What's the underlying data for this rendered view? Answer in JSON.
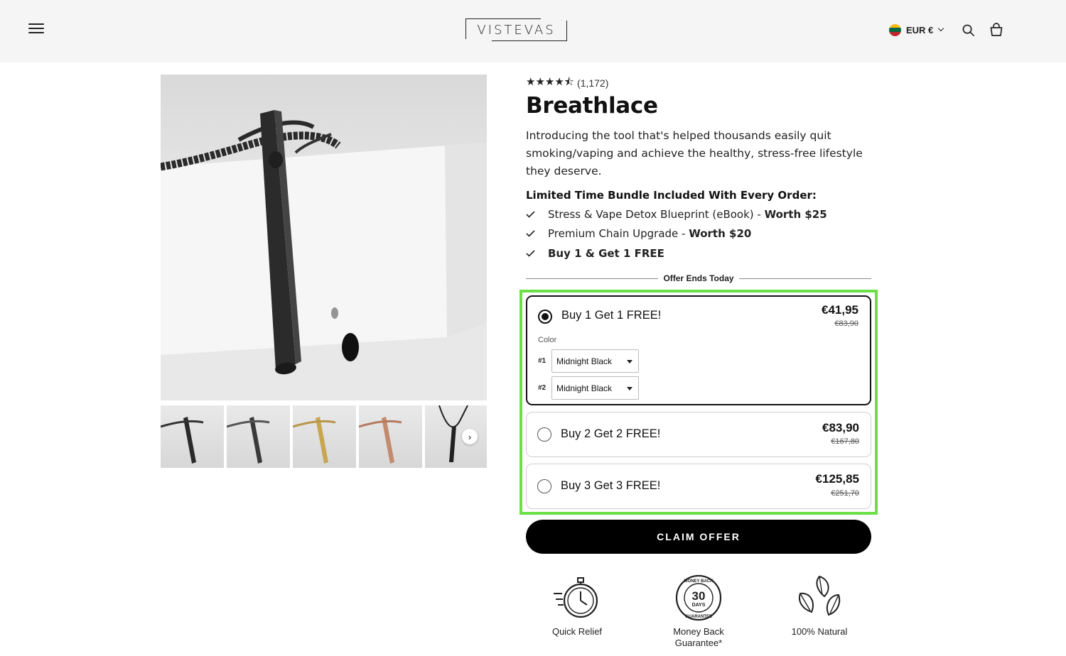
{
  "header": {
    "brand": "VISTEVAS",
    "currency": "EUR €",
    "icons": [
      "hamburger-menu-icon",
      "flag-icon",
      "chevron-down-icon",
      "search-icon",
      "cart-icon"
    ]
  },
  "gallery": {
    "thumbnails": [
      "black",
      "black-steel",
      "gold",
      "rose-gold",
      "black-on-cord"
    ]
  },
  "product": {
    "rating_stars": "★★★★⯪",
    "rating_value": 4.5,
    "review_count": "(1,172)",
    "title": "Breathlace",
    "description": "Introducing the tool that's helped thousands easily quit smoking/vaping and achieve the healthy, stress-free lifestyle they deserve.",
    "bundle_title": "Limited Time Bundle Included With Every Order:",
    "perks": [
      {
        "text": "Stress & Vape Detox Blueprint (eBook) - ",
        "bold": "Worth $25"
      },
      {
        "text": "Premium Chain Upgrade - ",
        "bold": "Worth $20"
      },
      {
        "text": "",
        "bold": "Buy 1 & Get 1 FREE"
      }
    ]
  },
  "offer": {
    "divider_label": "Offer Ends Today",
    "options": [
      {
        "label": "Buy 1 Get 1 FREE!",
        "price": "€41,95",
        "old_price": "€83,90",
        "selected": true
      },
      {
        "label": "Buy 2 Get 2 FREE!",
        "price": "€83,90",
        "old_price": "€167,80",
        "selected": false
      },
      {
        "label": "Buy 3 Get 3 FREE!",
        "price": "€125,85",
        "old_price": "€251,70",
        "selected": false
      }
    ],
    "color_label": "Color",
    "color_selects": [
      {
        "num": "#1",
        "value": "Midnight Black"
      },
      {
        "num": "#2",
        "value": "Midnight Black"
      }
    ],
    "cta": "CLAIM OFFER"
  },
  "badges": [
    {
      "label": "Quick Relief",
      "icon": "stopwatch-icon"
    },
    {
      "label": "Money Back Guarantee*",
      "icon": "money-back-seal-icon",
      "seal_top": "MONEY BACK",
      "seal_num": "30",
      "seal_days": "DAYS",
      "seal_bottom": "GUARANTEE"
    },
    {
      "label": "100% Natural",
      "icon": "leaves-icon"
    }
  ],
  "colors": {
    "highlight": "#6be046",
    "cta_bg": "#000000",
    "header_bg": "#f5f5f5"
  }
}
